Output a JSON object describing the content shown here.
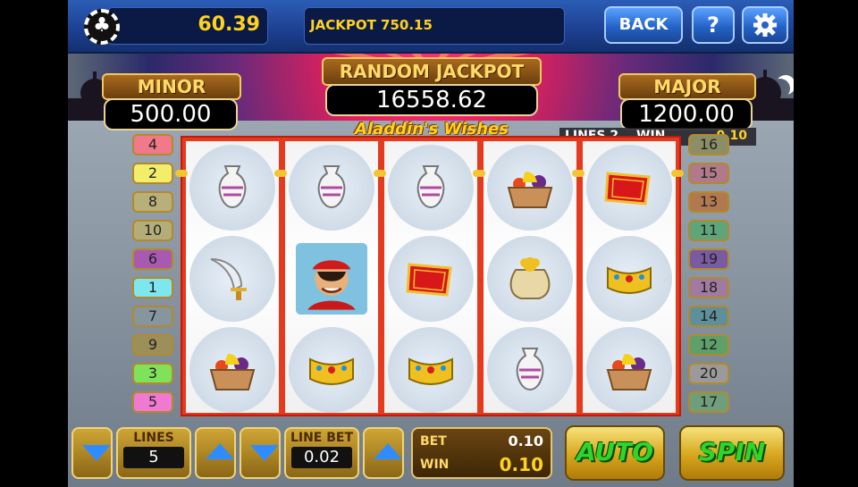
{
  "balance": "60.39",
  "jackpot_banner": "JACKPOT 750.15",
  "buttons": {
    "back": "BACK",
    "help": "?",
    "settings_icon": "gear-icon",
    "auto": "AUTO",
    "spin": "SPIN"
  },
  "jackpots": {
    "minor_label": "MINOR",
    "minor_value": "500.00",
    "random_label": "RANDOM JACKPOT",
    "random_value": "16558.62",
    "major_label": "MAJOR",
    "major_value": "1200.00"
  },
  "logo_text": "Aladdin's Wishes",
  "status": {
    "lines_label": "LINES 2",
    "win_label": "WIN",
    "win_value": "0.10"
  },
  "line_tabs_left": [
    {
      "n": "4",
      "color": "#f07a8a"
    },
    {
      "n": "2",
      "color": "#f2ee6a"
    },
    {
      "n": "8",
      "color": "#b9b079"
    },
    {
      "n": "10",
      "color": "#b4ad7a"
    },
    {
      "n": "6",
      "color": "#a85ab0"
    },
    {
      "n": "1",
      "color": "#7ee7ee"
    },
    {
      "n": "7",
      "color": "#86959e"
    },
    {
      "n": "9",
      "color": "#9c8f5a"
    },
    {
      "n": "3",
      "color": "#7fe25a"
    },
    {
      "n": "5",
      "color": "#f07ad2"
    }
  ],
  "line_tabs_right": [
    {
      "n": "16",
      "color": "#8c8f66"
    },
    {
      "n": "15",
      "color": "#b07a8a"
    },
    {
      "n": "13",
      "color": "#b0794f"
    },
    {
      "n": "11",
      "color": "#5fa57a"
    },
    {
      "n": "19",
      "color": "#7a5aa0"
    },
    {
      "n": "18",
      "color": "#a07aa0"
    },
    {
      "n": "14",
      "color": "#5f8f9a"
    },
    {
      "n": "12",
      "color": "#5fa06a"
    },
    {
      "n": "20",
      "color": "#9a9a9a"
    },
    {
      "n": "17",
      "color": "#6f9f7a"
    }
  ],
  "reels": [
    [
      "vase",
      "scimitar",
      "fruit-basket"
    ],
    [
      "vase",
      "aladdin",
      "crown"
    ],
    [
      "vase",
      "magic-carpet",
      "crown"
    ],
    [
      "fruit-basket",
      "treasure-sack",
      "vase"
    ],
    [
      "magic-carpet",
      "crown",
      "fruit-basket"
    ]
  ],
  "controls": {
    "lines_label": "LINES",
    "lines_value": "5",
    "linebet_label": "LINE BET",
    "linebet_value": "0.02",
    "bet_label": "BET",
    "bet_value": "0.10",
    "win_label": "WIN",
    "win_value": "0.10"
  },
  "colors": {
    "reel_frame": "#e43a1e",
    "gold": "#f3c530",
    "spin_text": "#2fd52a"
  }
}
